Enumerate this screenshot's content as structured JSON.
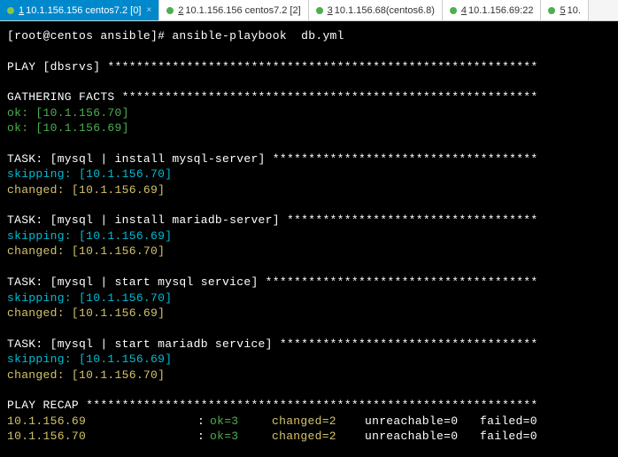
{
  "tabs": [
    {
      "num": "1",
      "label": "10.1.156.156 centos7.2 [0]",
      "active": true
    },
    {
      "num": "2",
      "label": "10.1.156.156 centos7.2 [2]",
      "active": false
    },
    {
      "num": "3",
      "label": "10.1.156.68(centos6.8)",
      "active": false
    },
    {
      "num": "4",
      "label": "10.1.156.69:22",
      "active": false
    },
    {
      "num": "5",
      "label": "10.",
      "active": false
    }
  ],
  "prompt": "[root@centos ansible]# ansible-playbook  db.yml",
  "play_header": "PLAY [dbsrvs] ************************************************************",
  "gathering_header": "GATHERING FACTS **********************************************************",
  "gather_ok1": "ok: [10.1.156.70]",
  "gather_ok2": "ok: [10.1.156.69]",
  "task1_header": "TASK: [mysql | install mysql-server] *************************************",
  "task1_skip": "skipping: [10.1.156.70]",
  "task1_changed": "changed: [10.1.156.69]",
  "task2_header": "TASK: [mysql | install mariadb-server] ***********************************",
  "task2_skip": "skipping: [10.1.156.69]",
  "task2_changed": "changed: [10.1.156.70]",
  "task3_header": "TASK: [mysql | start mysql service] **************************************",
  "task3_skip": "skipping: [10.1.156.70]",
  "task3_changed": "changed: [10.1.156.69]",
  "task4_header": "TASK: [mysql | start mariadb service] ************************************",
  "task4_skip": "skipping: [10.1.156.69]",
  "task4_changed": "changed: [10.1.156.70]",
  "recap_header": "PLAY RECAP ***************************************************************",
  "recap": [
    {
      "host": "10.1.156.69",
      "colon": ":",
      "ok": "ok=3",
      "changed": "changed=2",
      "unreachable": "unreachable=0",
      "failed": "failed=0"
    },
    {
      "host": "10.1.156.70",
      "colon": ":",
      "ok": "ok=3",
      "changed": "changed=2",
      "unreachable": "unreachable=0",
      "failed": "failed=0"
    }
  ]
}
